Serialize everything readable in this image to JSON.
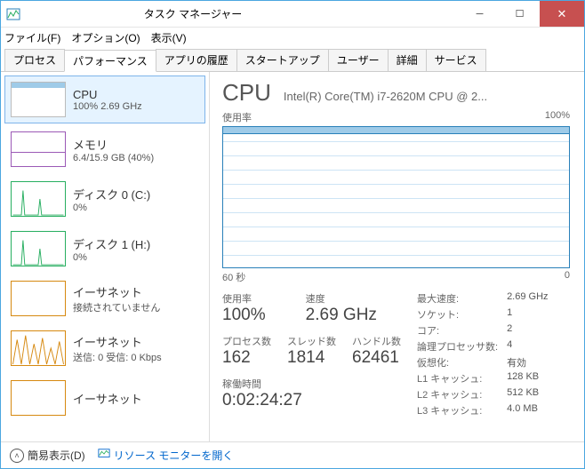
{
  "window": {
    "title": "タスク マネージャー"
  },
  "menu": {
    "file": "ファイル(F)",
    "options": "オプション(O)",
    "view": "表示(V)"
  },
  "tabs": [
    "プロセス",
    "パフォーマンス",
    "アプリの履歴",
    "スタートアップ",
    "ユーザー",
    "詳細",
    "サービス"
  ],
  "active_tab": 1,
  "sidebar": [
    {
      "label": "CPU",
      "value": "100% 2.69 GHz",
      "kind": "cpu",
      "selected": true
    },
    {
      "label": "メモリ",
      "value": "6.4/15.9 GB (40%)",
      "kind": "mem"
    },
    {
      "label": "ディスク 0 (C:)",
      "value": "0%",
      "kind": "disk"
    },
    {
      "label": "ディスク 1 (H:)",
      "value": "0%",
      "kind": "disk"
    },
    {
      "label": "イーサネット",
      "value": "接続されていません",
      "kind": "eth-off"
    },
    {
      "label": "イーサネット",
      "value": "送信: 0 受信: 0 Kbps",
      "kind": "eth"
    },
    {
      "label": "イーサネット",
      "value": "",
      "kind": "eth-off"
    }
  ],
  "main": {
    "title": "CPU",
    "subtitle": "Intel(R) Core(TM) i7-2620M CPU @ 2...",
    "chart_top_left": "使用率",
    "chart_top_right": "100%",
    "chart_bottom_left": "60 秒",
    "chart_bottom_right": "0",
    "statsL": {
      "util_k": "使用率",
      "util_v": "100%",
      "speed_k": "速度",
      "speed_v": "2.69 GHz",
      "proc_k": "プロセス数",
      "proc_v": "162",
      "thr_k": "スレッド数",
      "thr_v": "1814",
      "hnd_k": "ハンドル数",
      "hnd_v": "62461",
      "up_k": "稼働時間",
      "up_v": "0:02:24:27"
    },
    "statsR": {
      "max_k": "最大速度:",
      "max_v": "2.69 GHz",
      "sock_k": "ソケット:",
      "sock_v": "1",
      "core_k": "コア:",
      "core_v": "2",
      "lp_k": "論理プロセッサ数:",
      "lp_v": "4",
      "virt_k": "仮想化:",
      "virt_v": "有効",
      "l1_k": "L1 キャッシュ:",
      "l1_v": "128 KB",
      "l2_k": "L2 キャッシュ:",
      "l2_v": "512 KB",
      "l3_k": "L3 キャッシュ:",
      "l3_v": "4.0 MB"
    }
  },
  "footer": {
    "simple": "簡易表示(D)",
    "rmon": "リソース モニターを開く"
  },
  "chart_data": {
    "type": "line",
    "title": "使用率",
    "xlabel": "60 秒",
    "ylabel": "",
    "ylim": [
      0,
      100
    ],
    "x_seconds": [
      60,
      55,
      50,
      45,
      40,
      35,
      30,
      25,
      20,
      15,
      10,
      5,
      0
    ],
    "values": [
      98,
      97,
      99,
      98,
      97,
      99,
      98,
      100,
      99,
      97,
      98,
      99,
      98
    ]
  }
}
